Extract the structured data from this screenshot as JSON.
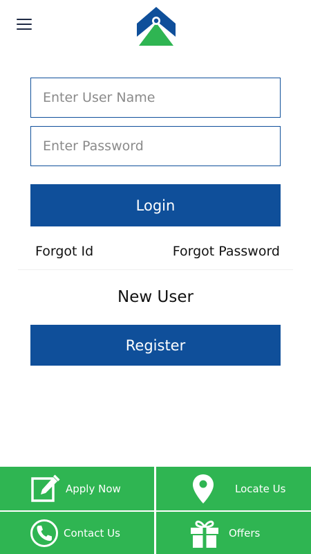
{
  "header": {
    "menu_icon": "hamburger-menu-icon",
    "logo_icon": "brand-logo-icon",
    "colors": {
      "brand_blue": "#0f4f9a",
      "brand_green": "#2fb552"
    }
  },
  "login": {
    "username_placeholder": "Enter User Name",
    "password_placeholder": "Enter Password",
    "login_label": "Login",
    "forgot_id": "Forgot Id",
    "forgot_password": "Forgot Password"
  },
  "register": {
    "heading": "New User",
    "button_label": "Register"
  },
  "bottom_nav": [
    {
      "label": "Apply Now",
      "icon": "edit-icon"
    },
    {
      "label": "Locate Us",
      "icon": "location-pin-icon"
    },
    {
      "label": "Contact Us",
      "icon": "phone-icon"
    },
    {
      "label": "Offers",
      "icon": "gift-icon"
    }
  ]
}
